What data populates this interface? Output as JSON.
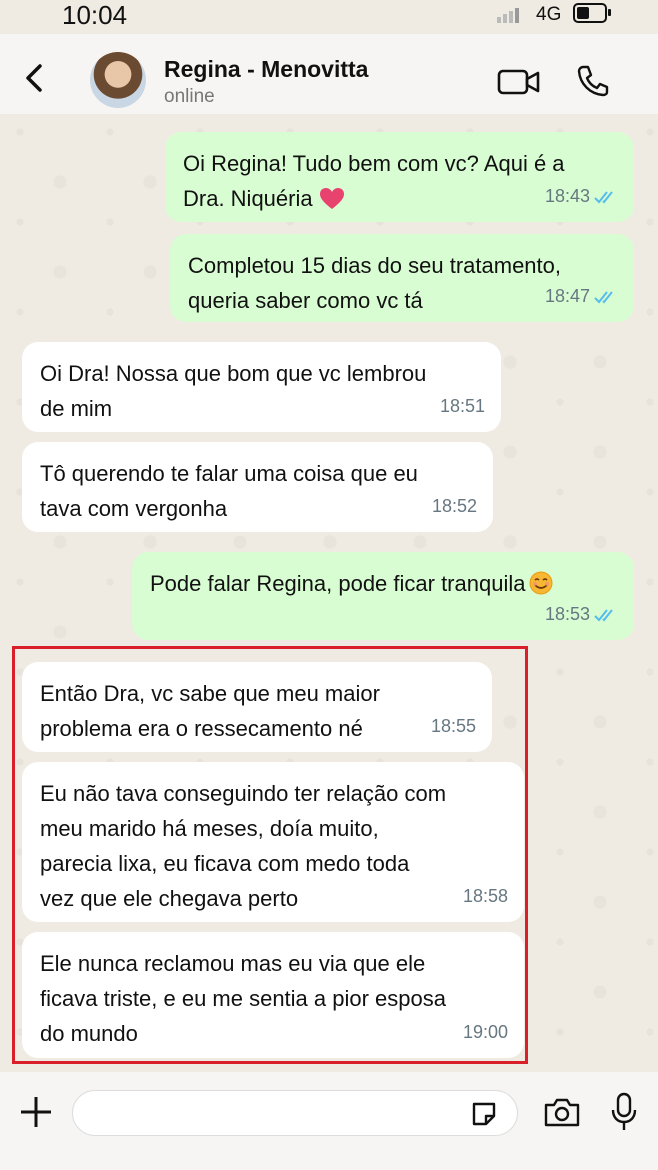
{
  "status_bar": {
    "time": "10:04",
    "network": "4G"
  },
  "header": {
    "contact_name": "Regina - Menovitta",
    "contact_status": "online"
  },
  "messages": [
    {
      "direction": "out",
      "text_lines": [
        "Oi Regina! Tudo bem com vc? Aqui é a",
        "Dra. Niquéria"
      ],
      "time": "18:43",
      "emoji": "heart"
    },
    {
      "direction": "out",
      "text_lines": [
        "Completou 15 dias do seu tratamento,",
        "queria saber como vc tá"
      ],
      "time": "18:47"
    },
    {
      "direction": "in",
      "text_lines": [
        "Oi Dra! Nossa que bom que vc lembrou",
        "de mim"
      ],
      "time": "18:51"
    },
    {
      "direction": "in",
      "text_lines": [
        "Tô querendo te falar uma coisa que eu",
        "tava com vergonha"
      ],
      "time": "18:52"
    },
    {
      "direction": "out",
      "text_lines": [
        "Pode falar Regina, pode ficar tranquila"
      ],
      "time": "18:53",
      "emoji": "smiling-face"
    },
    {
      "direction": "in",
      "text_lines": [
        "Então Dra, vc sabe que meu maior",
        "problema era o ressecamento né"
      ],
      "time": "18:55"
    },
    {
      "direction": "in",
      "text_lines": [
        "Eu não tava conseguindo ter relação com",
        "meu marido há meses, doía muito,",
        "parecia lixa, eu ficava com medo toda",
        "vez que ele chegava perto"
      ],
      "time": "18:58"
    },
    {
      "direction": "in",
      "text_lines": [
        "Ele nunca reclamou mas eu via que ele",
        "ficava triste, e eu me sentia a pior esposa",
        "do mundo"
      ],
      "time": "19:00"
    }
  ],
  "input": {
    "placeholder": ""
  },
  "colors": {
    "outgoing_bubble": "#d9fdd3",
    "incoming_bubble": "#ffffff",
    "highlight_border": "#d9202a",
    "read_tick": "#53bdeb"
  }
}
